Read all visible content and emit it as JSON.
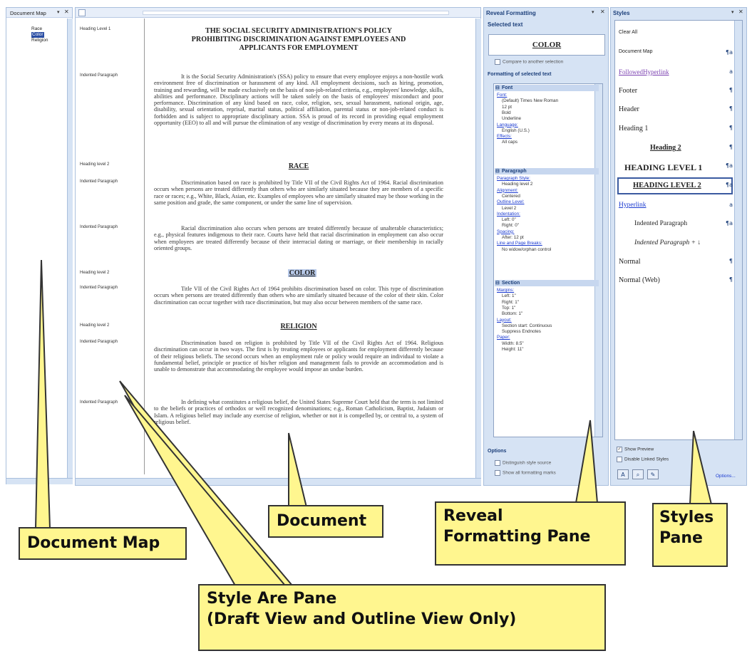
{
  "docmap": {
    "title": "Document Map",
    "items": [
      "Race",
      "Color",
      "Religion"
    ]
  },
  "style_area": {
    "labels": [
      "Heading Level 1",
      "Indented Paragraph",
      "Heading level 2",
      "Indented Paragraph",
      "Indented Paragraph",
      "Heading level 2",
      "Indented Paragraph",
      "Heading level 2",
      "Indented Paragraph",
      "Indented Paragraph"
    ]
  },
  "document": {
    "title_lines": [
      "THE SOCIAL SECURITY ADMINISTRATION'S POLICY",
      "PROHIBITING DISCRIMINATION AGAINST EMPLOYEES AND",
      "APPLICANTS FOR EMPLOYMENT"
    ],
    "p1": "It is the Social Security Administration's (SSA) policy to ensure that every employee enjoys a non-hostile work environment free of discrimination or harassment of any kind. All employment decisions, such as hiring, promotion, training and rewarding, will be made exclusively on the basis of non-job-related criteria, e.g., employees' knowledge, skills, abilities and performance. Disciplinary actions will be taken solely on the basis of employees' misconduct and poor performance. Discrimination of any kind based on race, color, religion, sex, sexual harassment, national origin, age, disability, sexual orientation, reprisal, marital status, political affiliation, parental status or non-job-related conduct is forbidden and is subject to appropriate disciplinary action. SSA is proud of its record in providing equal employment opportunity (EEO) to all and will pursue the elimination of any vestige of discrimination by every means at its disposal.",
    "h_race": "RACE",
    "p2": "Discrimination based on race is prohibited by Title VII of the Civil Rights Act of 1964. Racial discrimination occurs when persons are treated differently than others who are similarly situated because they are members of a specific race or races; e.g., White, Black, Asian, etc. Examples of employees who are similarly situated may be those working in the same position and grade, the same component, or under the same line of supervision.",
    "p3": "Racial discrimination also occurs when persons are treated differently because of unalterable characteristics; e.g., physical features indigenous to their race. Courts have held that racial discrimination in employment can also occur when employees are treated differently because of their interracial dating or marriage, or their membership in racially oriented groups.",
    "h_color": "COLOR",
    "p4": "Title VII of the Civil Rights Act of 1964 prohibits discrimination based on color. This type of discrimination occurs when persons are treated differently than others who are similarly situated because of the color of their skin. Color discrimination can occur together with race discrimination, but may also occur between members of the same race.",
    "h_religion": "RELIGION",
    "p5": "Discrimination based on religion is prohibited by Title VII of the Civil Rights Act of 1964. Religious discrimination can occur in two ways. The first is by treating employees or applicants for employment differently because of their religious beliefs. The second occurs when an employment rule or policy would require an individual to violate a fundamental belief, principle or practice of his/her religion and management fails to provide an accommodation and is unable to demonstrate that accommodating the employee would impose an undue burden.",
    "p6": "In defining what constitutes a religious belief, the United States Supreme Court held that the term is not limited to the beliefs or practices of orthodox or well recognized denominations; e.g., Roman Catholicism, Baptist, Judaism or Islam. A religious belief may include any exercise of religion, whether or not it is compelled by, or central to, a system of religious belief."
  },
  "reveal": {
    "title": "Reveal Formatting",
    "selected_label": "Selected text",
    "sample": "COLOR",
    "compare": "Compare to another selection",
    "formatting_label": "Formatting of selected text",
    "font_hdr": "Font",
    "font_lines": [
      {
        "t": "Font:",
        "link": true
      },
      {
        "t": "(Default) Times New Roman",
        "link": false
      },
      {
        "t": "12 pt",
        "link": false
      },
      {
        "t": "Bold",
        "link": false
      },
      {
        "t": "Underline",
        "link": false
      },
      {
        "t": "Language:",
        "link": true
      },
      {
        "t": "English (U.S.)",
        "link": false
      },
      {
        "t": "Effects:",
        "link": true
      },
      {
        "t": "All caps",
        "link": false
      }
    ],
    "para_hdr": "Paragraph",
    "para_lines": [
      {
        "t": "Paragraph Style:",
        "link": true
      },
      {
        "t": "Heading level 2",
        "link": false
      },
      {
        "t": "Alignment:",
        "link": true
      },
      {
        "t": "Centered",
        "link": false
      },
      {
        "t": "Outline Level:",
        "link": true
      },
      {
        "t": "Level 2",
        "link": false
      },
      {
        "t": "Indentation:",
        "link": true
      },
      {
        "t": "Left: 0\"",
        "link": false
      },
      {
        "t": "Right: 0\"",
        "link": false
      },
      {
        "t": "Spacing:",
        "link": true
      },
      {
        "t": "After: 12 pt",
        "link": false
      },
      {
        "t": "Line and Page Breaks:",
        "link": true
      },
      {
        "t": "No widow/orphan control",
        "link": false
      }
    ],
    "sect_hdr": "Section",
    "sect_lines": [
      {
        "t": "Margins:",
        "link": true
      },
      {
        "t": "Left: 1\"",
        "link": false
      },
      {
        "t": "Right: 1\"",
        "link": false
      },
      {
        "t": "Top: 1\"",
        "link": false
      },
      {
        "t": "Bottom: 1\"",
        "link": false
      },
      {
        "t": "Layout:",
        "link": true
      },
      {
        "t": "Section start: Continuous",
        "link": false
      },
      {
        "t": "Suppress Endnotes",
        "link": false
      },
      {
        "t": "Paper:",
        "link": true
      },
      {
        "t": "Width: 8.5\"",
        "link": false
      },
      {
        "t": "Height: 11\"",
        "link": false
      }
    ],
    "options_label": "Options",
    "opt1": "Distinguish style source",
    "opt2": "Show all formatting marks"
  },
  "styles": {
    "title": "Styles",
    "items": [
      {
        "label": "Clear All",
        "icon": ""
      },
      {
        "label": "Document Map",
        "icon": "¶a"
      },
      {
        "label": "FollowedHyperlink",
        "icon": "a"
      },
      {
        "label": "Footer",
        "icon": "¶"
      },
      {
        "label": "Header",
        "icon": "¶"
      },
      {
        "label": "Heading 1",
        "icon": "¶"
      },
      {
        "label": "Heading 2",
        "icon": "¶"
      },
      {
        "label": "HEADING LEVEL 1",
        "icon": "¶a"
      },
      {
        "label": "HEADING LEVEL 2",
        "icon": "¶a"
      },
      {
        "label": "Hyperlink",
        "icon": "a"
      },
      {
        "label": "Indented Paragraph",
        "icon": "¶a"
      },
      {
        "label": "Indented Paragraph + ↓",
        "icon": ""
      },
      {
        "label": "Normal",
        "icon": "¶"
      },
      {
        "label": "Normal (Web)",
        "icon": "¶"
      }
    ],
    "show_preview": "Show Preview",
    "disable_linked": "Disable Linked Styles",
    "options": "Options..."
  },
  "callouts": {
    "doc_map": "Document Map",
    "document": "Document",
    "reveal": [
      "Reveal",
      "Formatting Pane"
    ],
    "styles": [
      "Styles",
      "Pane"
    ],
    "style_area": [
      "Style Are Pane",
      "(Draft View and Outline View Only)"
    ]
  },
  "colors": {
    "pane_bg": "#d6e3f4",
    "title_text": "#1c3f7a",
    "callout_fill": "#fff68f"
  }
}
